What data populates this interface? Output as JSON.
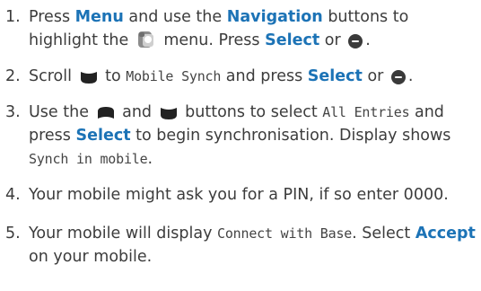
{
  "steps": [
    {
      "num": "1.",
      "t1": "Press ",
      "menu": "Menu",
      "t2": " and use the ",
      "navigation": "Navigation",
      "t3": " buttons to highlight the ",
      "icon": "phonebook-synch-icon",
      "t4": " menu. Press ",
      "select": "Select",
      "t5": " or ",
      "ok_icon": "ok-button-icon",
      "t6": "."
    },
    {
      "num": "2.",
      "t1": "Scroll ",
      "icon": "scroll-down-icon",
      "t2": " to ",
      "lcd": "Mobile Synch",
      "t3": " and press ",
      "select": "Select",
      "t4": " or ",
      "ok_icon": "ok-button-icon",
      "t5": "."
    },
    {
      "num": "3.",
      "t1": "Use the ",
      "icon_up": "scroll-up-icon",
      "t2": " and ",
      "icon_down": "scroll-down-icon",
      "t3": " buttons to select ",
      "lcd1": "All Entries",
      "t4": " and press ",
      "select": "Select",
      "t5": " to begin synchronisation. Display shows ",
      "lcd2": "Synch in mobile",
      "t6": "."
    },
    {
      "num": "4.",
      "t1": "Your mobile might ask you for a PIN, if so enter 0000."
    },
    {
      "num": "5.",
      "t1": "Your mobile will display ",
      "lcd": "Connect with Base",
      "t2": ". Select ",
      "accept": "Accept",
      "t3": " on your mobile."
    }
  ],
  "colors": {
    "accent": "#1c73b6",
    "text": "#3c3c3c"
  }
}
